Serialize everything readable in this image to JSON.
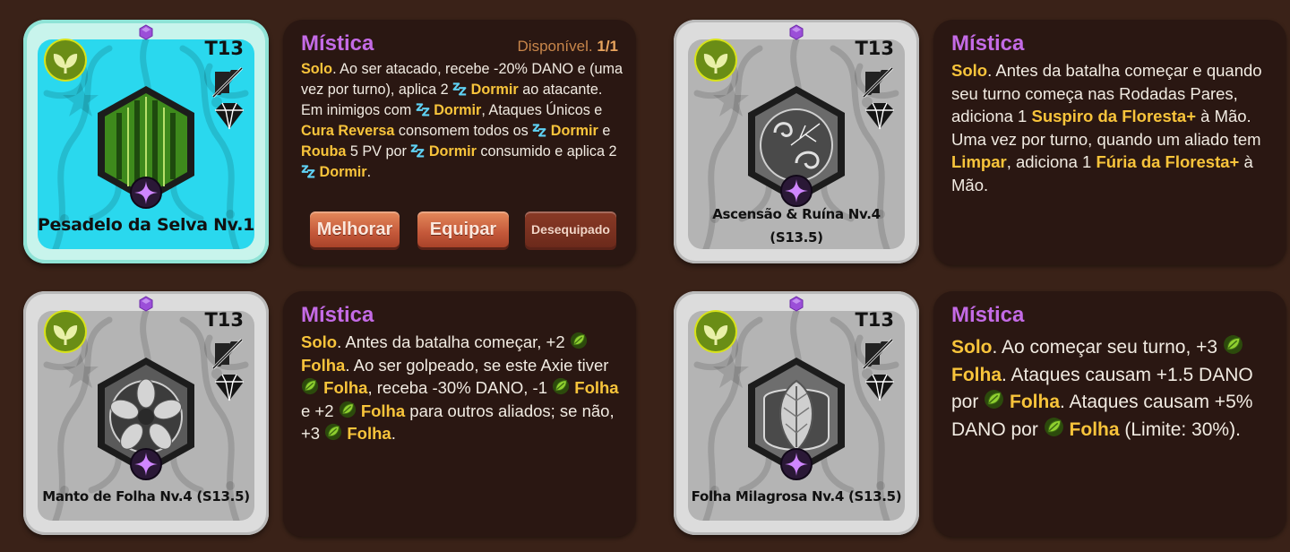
{
  "colors": {
    "background": "#3a2218",
    "panel": "#2a1712",
    "mystic_title": "#c46be6",
    "keyword": "#f8c43b",
    "text": "#f1ebe2",
    "active_card_bg": "#2ad8ee",
    "button": "#c4583a"
  },
  "cards": [
    {
      "tier": "T13",
      "name": "Pesadelo da Selva Nv.1",
      "season": "",
      "active": true,
      "art_icon": "melon-cactus-icon",
      "panel": {
        "title": "Mística",
        "available_label": "Disponível.",
        "available_count": "1/1",
        "buttons": {
          "upgrade": "Melhorar",
          "equip": "Equipar",
          "unequip": "Desequipado"
        }
      }
    },
    {
      "tier": "T13",
      "name": "Ascensão & Ruína Nv.4",
      "season": "(S13.5)",
      "active": false,
      "art_icon": "swirl-icon",
      "panel": {
        "title": "Mística"
      }
    },
    {
      "tier": "T13",
      "name": "Manto de Folha Nv.4 (S13.5)",
      "season": "",
      "active": false,
      "art_icon": "leaf-wheel-icon",
      "panel": {
        "title": "Mística"
      }
    },
    {
      "tier": "T13",
      "name": "Folha Milagrosa Nv.4 (S13.5)",
      "season": "",
      "active": false,
      "art_icon": "leaf-shield-icon",
      "panel": {
        "title": "Mística"
      }
    }
  ],
  "descriptions": {
    "d1": {
      "solo": "Solo",
      "t1": ". Ao ser atacado, recebe -20% DANO e (uma vez por turno), aplica 2 ",
      "dormir": "Dormir",
      "t2": " ao atacante. Em inimigos com ",
      "t3": ", Ataques Únicos e ",
      "cura": "Cura Reversa",
      "t4": " consomem todos os ",
      "t5": " e ",
      "rouba": "Rouba",
      "t6": " 5 PV por ",
      "t7": " consumido e aplica 2 ",
      "t8": "."
    },
    "d2": {
      "solo": "Solo",
      "t1": ". Antes da batalha começar e quando seu turno começa nas Rodadas Pares, adiciona 1 ",
      "suspiro": "Suspiro da Floresta+",
      "t2": " à Mão. Uma vez por turno, quando um aliado tem ",
      "limpar": "Limpar",
      "t3": ", adiciona 1 ",
      "furia": "Fúria da Floresta+",
      "t4": " à Mão."
    },
    "d3": {
      "solo": "Solo",
      "t1": ". Antes da batalha começar, +2 ",
      "folha": "Folha",
      "t2": ". Ao ser golpeado, se este Axie tiver ",
      "t3": ", receba -30% DANO, -1 ",
      "t4": " e +2 ",
      "t5": " para outros aliados; se não, +3 ",
      "t6": "."
    },
    "d4": {
      "solo": "Solo",
      "t1": ". Ao começar seu turno, +3 ",
      "folha": "Folha",
      "t2": ". Ataques causam +1.5 DANO por ",
      "t3": ". Ataques causam +5% DANO por ",
      "t4": " (Limite: 30%)."
    }
  },
  "icons": {
    "gem": "purple-hexagon-gem-icon",
    "class": "plant-class-icon",
    "no_attack": "no-attack-icon",
    "diamond": "diamond-icon",
    "mystic": "mystic-star-icon",
    "sleep": "sleep-zz-icon",
    "leaf": "leaf-icon"
  }
}
